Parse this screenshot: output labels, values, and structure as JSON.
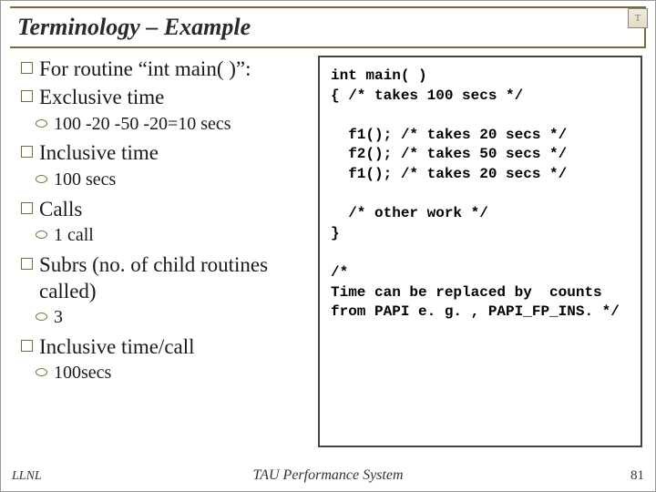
{
  "header": {
    "title": "Terminology – Example",
    "logo_text": "T"
  },
  "left": {
    "items": [
      {
        "label": "For routine “int main( )”:"
      },
      {
        "label": "Exclusive time",
        "sub": "100 -20 -50 -20=10 secs"
      },
      {
        "label": "Inclusive time",
        "sub": "100 secs"
      },
      {
        "label": "Calls",
        "sub": "1 call"
      },
      {
        "label": "Subrs (no. of child routines called)",
        "sub": "3"
      },
      {
        "label": "Inclusive time/call",
        "sub": "100secs"
      }
    ]
  },
  "code": {
    "l01": "int main( )",
    "l02": "{ /* takes 100 secs */",
    "l03": "",
    "l04": "  f1(); /* takes 20 secs */",
    "l05": "  f2(); /* takes 50 secs */",
    "l06": "  f1(); /* takes 20 secs */",
    "l07": "",
    "l08": "  /* other work */",
    "l09": "}",
    "l10": "",
    "l11": "/*",
    "l12": "Time can be replaced by  counts",
    "l13": "from PAPI e. g. , PAPI_FP_INS. */"
  },
  "footer": {
    "left": "LLNL",
    "center": "TAU Performance System",
    "page": "81"
  }
}
